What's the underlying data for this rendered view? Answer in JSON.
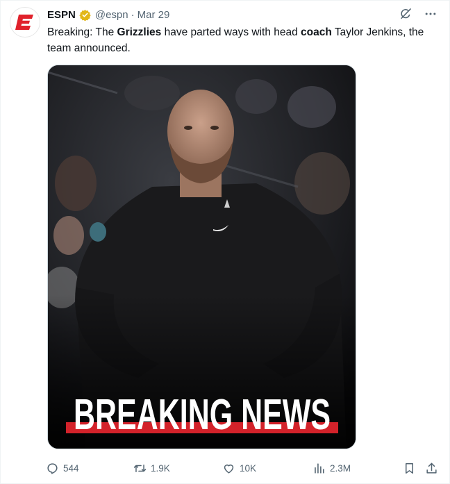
{
  "tweet": {
    "author_name": "ESPN",
    "handle": "@espn",
    "separator": "·",
    "date": "Mar 29",
    "text": {
      "p1": "Breaking: The ",
      "bold1": "Grizzlies",
      "p2": " have parted ways with head ",
      "bold2": "coach",
      "p3": " Taylor Jenkins, the team announced."
    },
    "media": {
      "banner_text": "BREAKING NEWS"
    }
  },
  "actions": {
    "replies": "544",
    "retweets": "1.9K",
    "likes": "10K",
    "views": "2.3M"
  },
  "colors": {
    "espn_red": "#e0212b",
    "verified_gold": "#e2b719",
    "muted": "#536471",
    "banner_red": "#d3222a"
  },
  "icons": {
    "top": [
      "grok-icon",
      "more-icon"
    ],
    "actions": [
      "reply-icon",
      "retweet-icon",
      "like-icon",
      "views-icon",
      "bookmark-icon",
      "share-icon"
    ]
  }
}
